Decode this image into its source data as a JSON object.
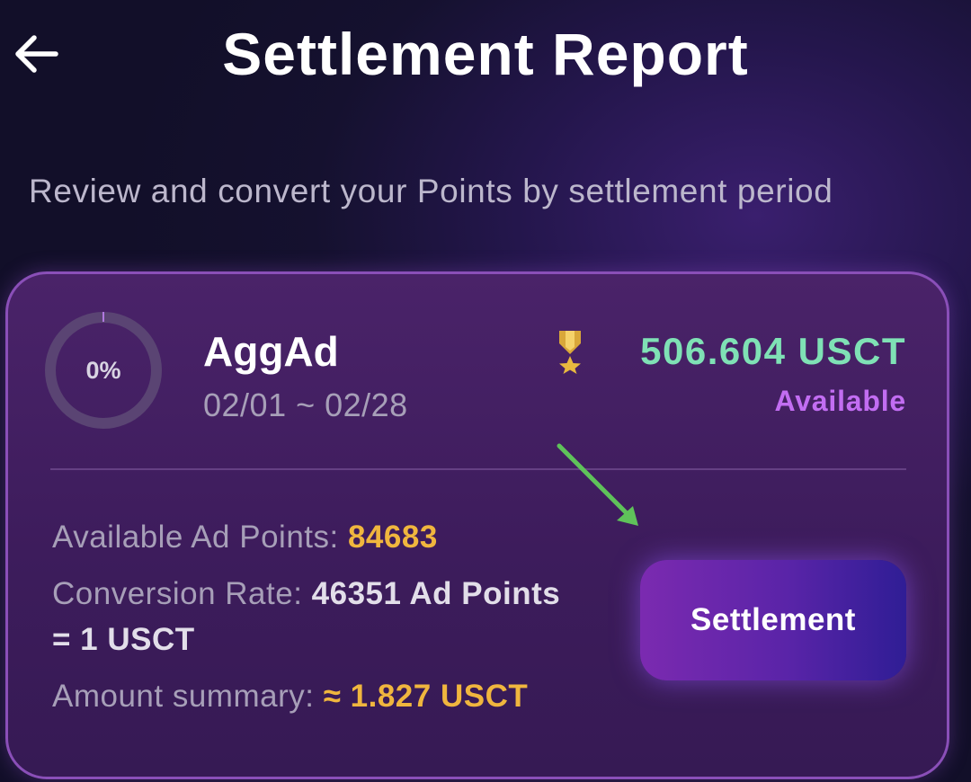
{
  "header": {
    "title": "Settlement Report",
    "back_icon": "arrow-left-icon"
  },
  "subtitle": "Review and convert your Points by settlement period",
  "card": {
    "progress_percent": 0,
    "progress_label": "0%",
    "program_name": "AggAd",
    "period": "02/01 ~ 02/28",
    "medal_icon": "medal-icon",
    "balance": "506.604 USCT",
    "balance_status": "Available",
    "available_points_label": "Available Ad Points: ",
    "available_points_value": "84683",
    "conversion_rate_label": "Conversion Rate: ",
    "conversion_rate_value_1": "46351 Ad Points",
    "conversion_rate_value_2": "= 1 USCT",
    "amount_summary_label": "Amount summary: ",
    "amount_summary_value": "≈ 1.827 USCT",
    "settle_button_label": "Settlement"
  },
  "colors": {
    "accent_green": "#7fe1b5",
    "accent_purple": "#c26df2",
    "accent_yellow": "#f0b63e",
    "annotation_arrow": "#5fc25a"
  }
}
